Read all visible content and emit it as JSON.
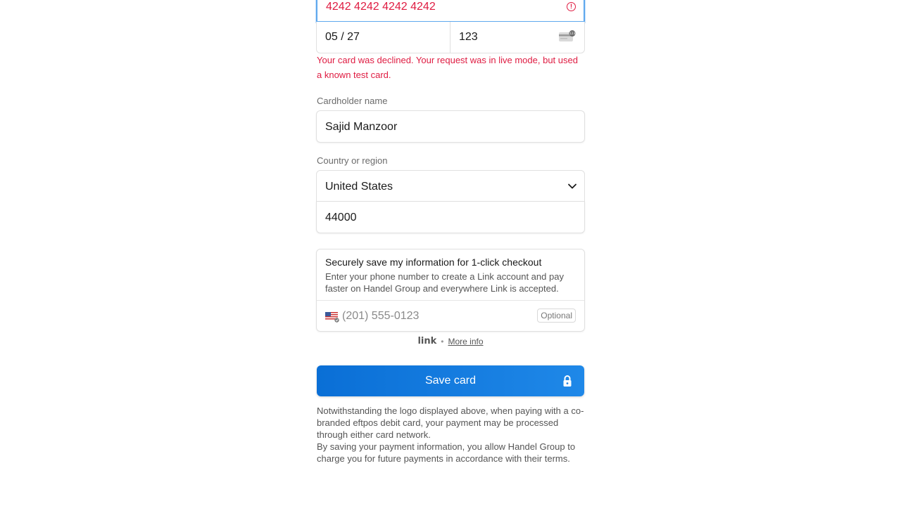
{
  "card": {
    "number": "4242 4242 4242 4242",
    "expiry": "05 / 27",
    "cvc": "123",
    "error": "Your card was declined. Your request was in live mode, but used a known test card."
  },
  "cardholder": {
    "label": "Cardholder name",
    "value": "Sajid Manzoor"
  },
  "country": {
    "label": "Country or region",
    "selected": "United States",
    "postal": "44000"
  },
  "link": {
    "title": "Securely save my information for 1-click checkout",
    "description": "Enter your phone number to create a Link account and pay faster on Handel Group and everywhere Link is accepted.",
    "phone_placeholder": "(201) 555-0123",
    "optional": "Optional",
    "logo": "link",
    "more_info": "More info"
  },
  "save_button": {
    "label": "Save card"
  },
  "footer": {
    "notice": "Notwithstanding the logo displayed above, when paying with a co-branded eftpos debit card, your payment may be processed through either card network.",
    "terms": "By saving your payment information, you allow Handel Group to charge you for future payments in accordance with their terms."
  },
  "colors": {
    "error": "#df1b41",
    "focus_border": "#5fa8ed",
    "button": "#0a6fd6"
  },
  "icons": [
    "error-icon",
    "cvc-card-icon",
    "chevron-down-icon",
    "us-flag-icon",
    "lock-icon"
  ]
}
